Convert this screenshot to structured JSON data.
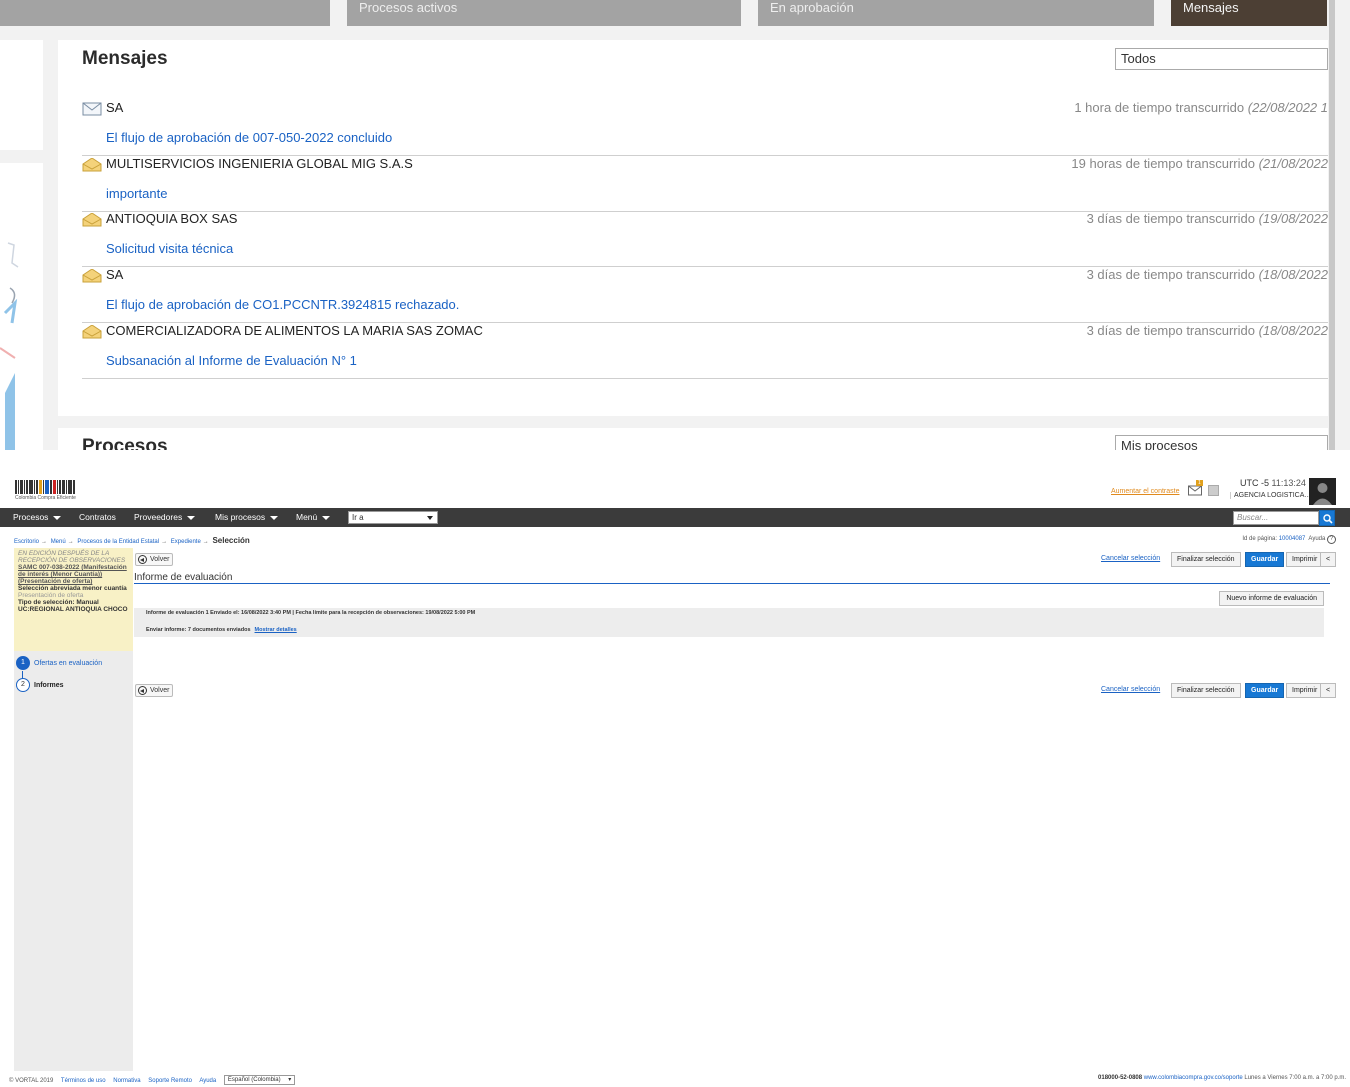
{
  "dashboard": {
    "tabs": [
      {
        "label": "Procesos activos"
      },
      {
        "label": "En aprobación"
      },
      {
        "label": "Mensajes"
      }
    ],
    "messages_panel": {
      "title": "Mensajes",
      "filter_value": "Todos",
      "items": [
        {
          "sender": "SA",
          "time": "1 hora de tiempo transcurrido",
          "date": "(22/08/2022 1",
          "subject": "El flujo de aprobación de 007-050-2022 concluido",
          "read": false
        },
        {
          "sender": "MULTISERVICIOS INGENIERIA GLOBAL MIG S.A.S",
          "time": "19 horas de tiempo transcurrido",
          "date": "(21/08/2022",
          "subject": "importante",
          "read": true
        },
        {
          "sender": "ANTIOQUIA BOX SAS",
          "time": "3 días de tiempo transcurrido",
          "date": "(19/08/2022",
          "subject": "Solicitud visita técnica",
          "read": true
        },
        {
          "sender": "SA",
          "time": "3 días de tiempo transcurrido",
          "date": "(18/08/2022",
          "subject": "El flujo de aprobación de CO1.PCCNTR.3924815 rechazado.",
          "read": true
        },
        {
          "sender": "COMERCIALIZADORA DE ALIMENTOS LA MARIA SAS ZOMAC",
          "time": "3 días de tiempo transcurrido",
          "date": "(18/08/2022",
          "subject": "Subsanación al Informe de Evaluación N° 1",
          "read": true
        }
      ]
    },
    "processes_panel": {
      "title": "Procesos",
      "filter_value": "Mis procesos"
    }
  },
  "app": {
    "logo_text": "Colombia Compra Eficiente",
    "header": {
      "increase_font": "Aumentar el contraste",
      "mail_badge": "1",
      "timezone": "UTC -5",
      "time": "11:13:24",
      "agency": "AGENCIA LOGISTICA..."
    },
    "nav": {
      "items": [
        {
          "label": "Procesos",
          "dropdown": true
        },
        {
          "label": "Contratos",
          "dropdown": false
        },
        {
          "label": "Proveedores",
          "dropdown": true
        },
        {
          "label": "Mis procesos",
          "dropdown": true
        },
        {
          "label": "Menú",
          "dropdown": true
        }
      ],
      "goto_value": "Ir a",
      "search_placeholder": "Buscar..."
    },
    "breadcrumb": {
      "items": [
        "Escritorio",
        "Menú",
        "Procesos de la Entidad Estatal",
        "Expediente"
      ],
      "current": "Selección"
    },
    "page_id": {
      "label": "Id de página:",
      "value": "10004087",
      "help": "Ayuda"
    },
    "sidebar": {
      "state": "EN EDICIÓN DESPUÉS DE LA RECEPCIÓN DE OBSERVACIONES",
      "process": "SAMC 007-038-2022 (Manifestación de interés (Menor Cuantía)) (Presentación de oferta)",
      "modality": "Selección abreviada menor cuantía",
      "phase": "Presentación de oferta",
      "selection_type": "Tipo de selección: Manual",
      "unit": "UC:REGIONAL ANTIOQUIA CHOCO",
      "steps": [
        {
          "number": "1",
          "label": "Ofertas en evaluación"
        },
        {
          "number": "2",
          "label": "Informes"
        }
      ]
    },
    "actions": {
      "back": "Volver",
      "cancel": "Cancelar selección",
      "finish": "Finalizar selección",
      "save": "Guardar",
      "print": "Imprimir",
      "collapse": "<"
    },
    "main": {
      "section_title": "Informe de evaluación",
      "new_report_button": "Nuevo informe de evaluación",
      "report_line1": "Informe de evaluación 1  Enviado el: 16/08/2022 3:40 PM | Fecha límite para la recepción de observaciones: 19/08/2022 5:00 PM",
      "report_line2": "Enviar informe:  7 documentos enviados",
      "show_details": "Mostrar detalles"
    },
    "footer": {
      "copyright": "© VORTAL 2019",
      "links": [
        "Términos de uso",
        "Normativa",
        "Soporte Remoto",
        "Ayuda"
      ],
      "language": "Español (Colombia)",
      "phone": "018000-52-0808",
      "support_url": "www.colombiacompra.gov.co/soporte",
      "hours": "Lunes a Viernes 7:00 a.m. a 7:00 p.m."
    }
  }
}
